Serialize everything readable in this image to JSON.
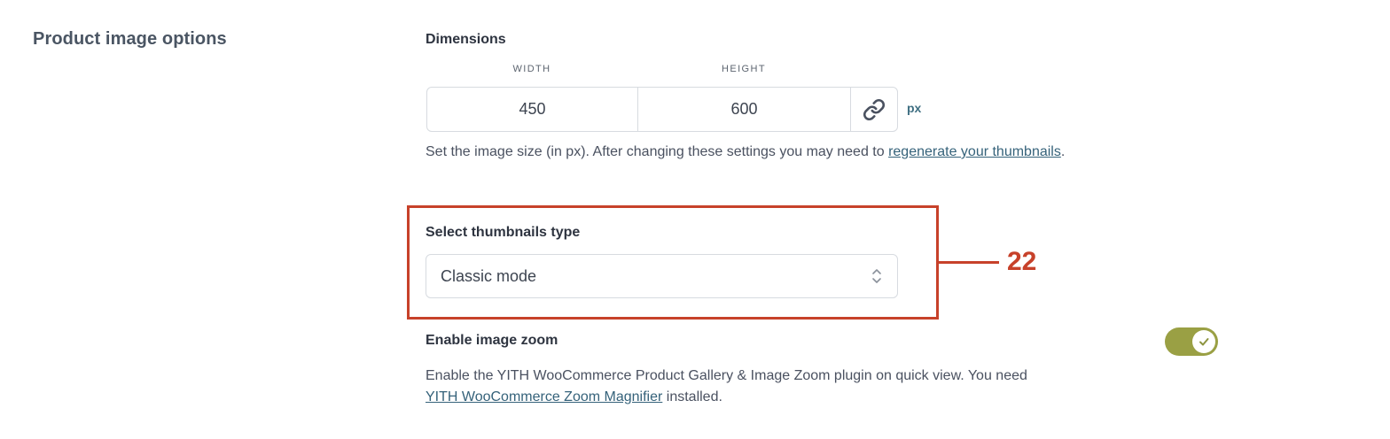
{
  "section": {
    "title": "Product image options"
  },
  "dimensions": {
    "label": "Dimensions",
    "width_label": "WIDTH",
    "height_label": "HEIGHT",
    "width_value": "450",
    "height_value": "600",
    "unit": "px",
    "help_prefix": "Set the image size (in px). After changing these settings you may need to ",
    "help_link": "regenerate your thumbnails",
    "help_suffix": "."
  },
  "thumbnails": {
    "label": "Select thumbnails type",
    "selected": "Classic mode"
  },
  "annotation": {
    "number": "22",
    "color": "#c7412a"
  },
  "zoom": {
    "label": "Enable image zoom",
    "enabled": true,
    "toggle_color": "#9aa044",
    "help_prefix": "Enable the YITH WooCommerce Product Gallery & Image Zoom plugin on quick view. You need ",
    "help_link": "YITH WooCommerce Zoom Magnifier",
    "help_suffix": " installed."
  },
  "icons": {
    "link": "link-chain-icon",
    "select_arrows": "chevron-up-down-icon",
    "check": "check-icon"
  }
}
